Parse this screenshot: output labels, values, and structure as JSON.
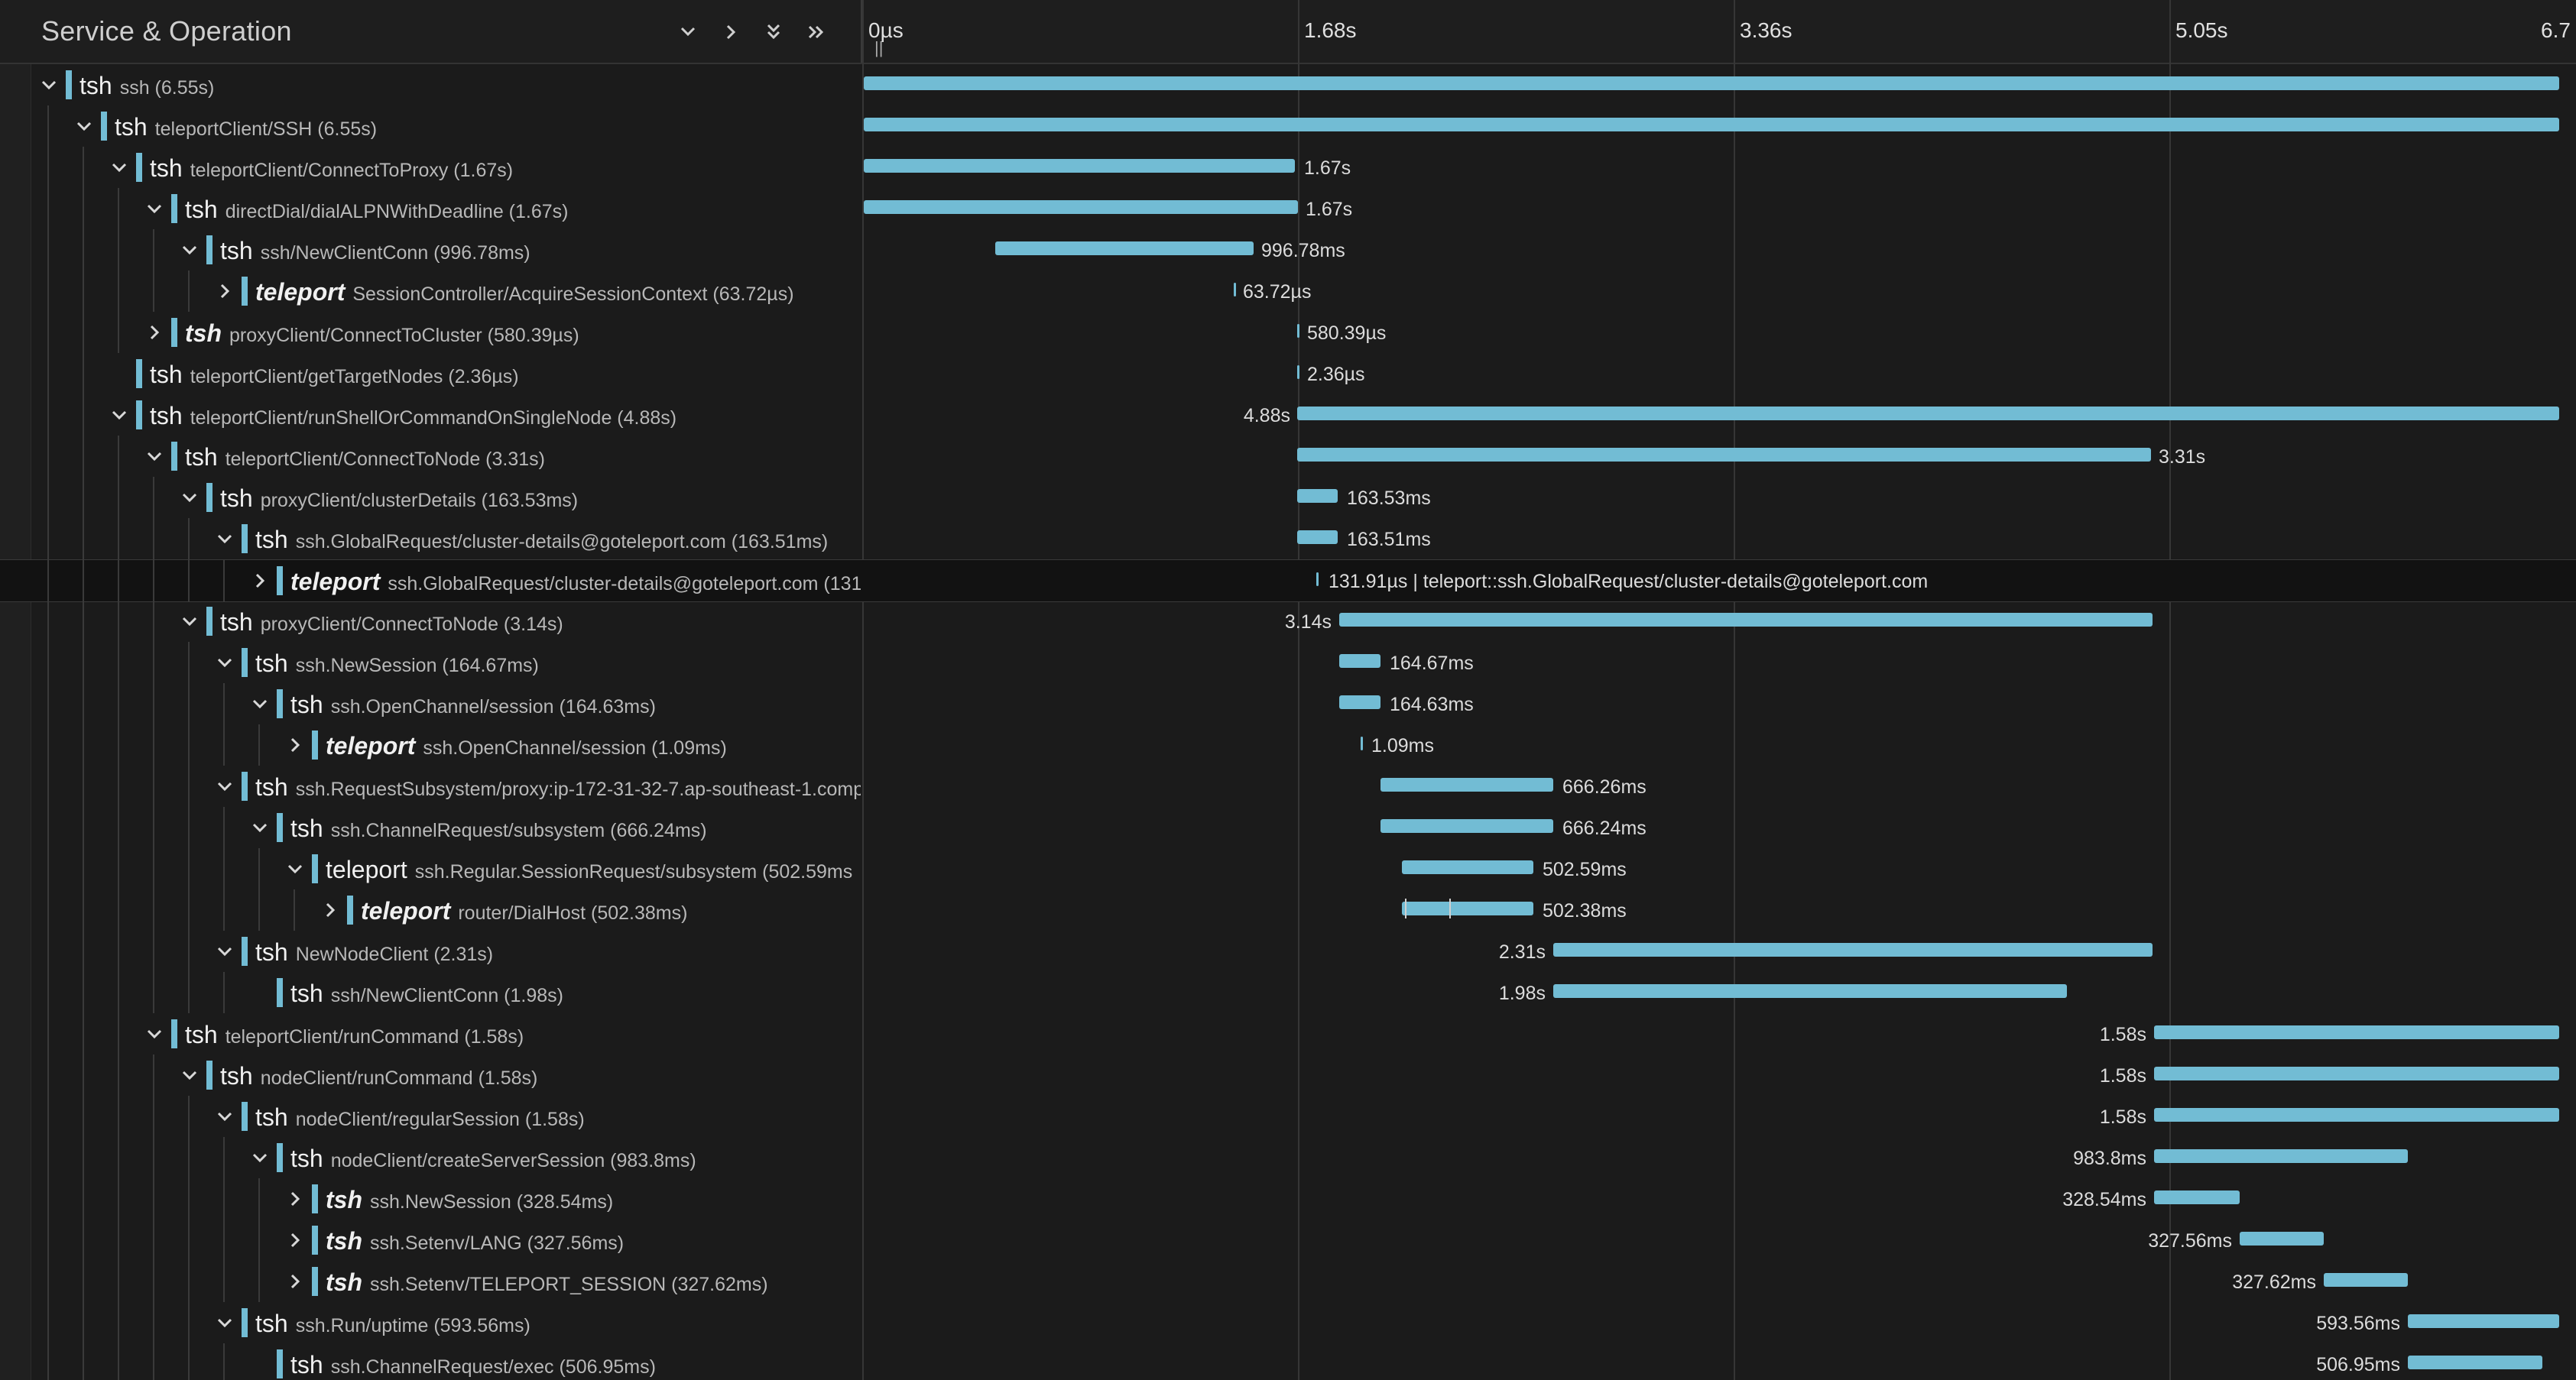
{
  "header": {
    "title": "Service & Operation",
    "ticks": [
      "0µs",
      "1.68s",
      "3.36s",
      "5.05s",
      "6.7"
    ]
  },
  "rows": [
    {
      "service": "tsh",
      "operation": "ssh (6.55s)",
      "label": ""
    },
    {
      "service": "tsh",
      "operation": "teleportClient/SSH (6.55s)",
      "label": ""
    },
    {
      "service": "tsh",
      "operation": "teleportClient/ConnectToProxy (1.67s)",
      "label": "1.67s"
    },
    {
      "service": "tsh",
      "operation": "directDial/dialALPNWithDeadline (1.67s)",
      "label": "1.67s"
    },
    {
      "service": "tsh",
      "operation": "ssh/NewClientConn (996.78ms)",
      "label": "996.78ms"
    },
    {
      "service": "teleport",
      "operation": "SessionController/AcquireSessionContext (63.72µs)",
      "label": "63.72µs"
    },
    {
      "service": "tsh",
      "operation": "proxyClient/ConnectToCluster (580.39µs)",
      "label": "580.39µs"
    },
    {
      "service": "tsh",
      "operation": "teleportClient/getTargetNodes (2.36µs)",
      "label": "2.36µs"
    },
    {
      "service": "tsh",
      "operation": "teleportClient/runShellOrCommandOnSingleNode (4.88s)",
      "label": "4.88s"
    },
    {
      "service": "tsh",
      "operation": "teleportClient/ConnectToNode (3.31s)",
      "label": "3.31s"
    },
    {
      "service": "tsh",
      "operation": "proxyClient/clusterDetails (163.53ms)",
      "label": "163.53ms"
    },
    {
      "service": "tsh",
      "operation": "ssh.GlobalRequest/cluster-details@goteleport.com (163.51ms)",
      "label": "163.51ms"
    },
    {
      "service": "teleport",
      "operation": "ssh.GlobalRequest/cluster-details@goteleport.com (131",
      "label": "131.91µs | teleport::ssh.GlobalRequest/cluster-details@goteleport.com"
    },
    {
      "service": "tsh",
      "operation": "proxyClient/ConnectToNode (3.14s)",
      "label": "3.14s"
    },
    {
      "service": "tsh",
      "operation": "ssh.NewSession (164.67ms)",
      "label": "164.67ms"
    },
    {
      "service": "tsh",
      "operation": "ssh.OpenChannel/session (164.63ms)",
      "label": "164.63ms"
    },
    {
      "service": "teleport",
      "operation": "ssh.OpenChannel/session (1.09ms)",
      "label": "1.09ms"
    },
    {
      "service": "tsh",
      "operation": "ssh.RequestSubsystem/proxy:ip-172-31-32-7.ap-southeast-1.comp",
      "label": "666.26ms"
    },
    {
      "service": "tsh",
      "operation": "ssh.ChannelRequest/subsystem (666.24ms)",
      "label": "666.24ms"
    },
    {
      "service": "teleport",
      "operation": "ssh.Regular.SessionRequest/subsystem (502.59ms",
      "label": "502.59ms"
    },
    {
      "service": "teleport",
      "operation": "router/DialHost (502.38ms)",
      "label": "502.38ms"
    },
    {
      "service": "tsh",
      "operation": "NewNodeClient (2.31s)",
      "label": "2.31s"
    },
    {
      "service": "tsh",
      "operation": "ssh/NewClientConn (1.98s)",
      "label": "1.98s"
    },
    {
      "service": "tsh",
      "operation": "teleportClient/runCommand (1.58s)",
      "label": "1.58s"
    },
    {
      "service": "tsh",
      "operation": "nodeClient/runCommand (1.58s)",
      "label": "1.58s"
    },
    {
      "service": "tsh",
      "operation": "nodeClient/regularSession (1.58s)",
      "label": "1.58s"
    },
    {
      "service": "tsh",
      "operation": "nodeClient/createServerSession (983.8ms)",
      "label": "983.8ms"
    },
    {
      "service": "tsh",
      "operation": "ssh.NewSession (328.54ms)",
      "label": "328.54ms"
    },
    {
      "service": "tsh",
      "operation": "ssh.Setenv/LANG (327.56ms)",
      "label": "327.56ms"
    },
    {
      "service": "tsh",
      "operation": "ssh.Setenv/TELEPORT_SESSION (327.62ms)",
      "label": "327.62ms"
    },
    {
      "service": "tsh",
      "operation": "ssh.Run/uptime (593.56ms)",
      "label": "593.56ms"
    },
    {
      "service": "tsh",
      "operation": "ssh.ChannelRequest/exec (506.95ms)",
      "label": "506.95ms"
    }
  ]
}
